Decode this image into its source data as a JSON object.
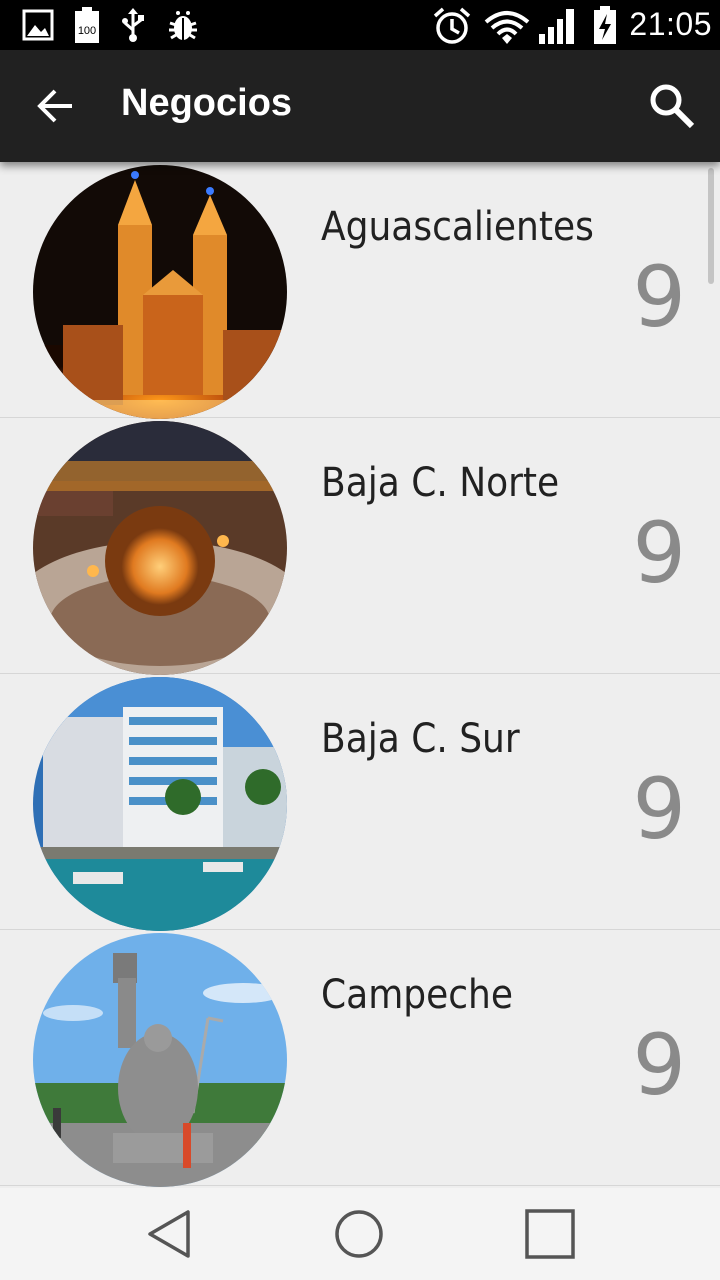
{
  "status_bar": {
    "time": "21:05",
    "battery_text": "100",
    "icons": [
      "image-icon",
      "battery-full-icon",
      "usb-icon",
      "bug-icon",
      "alarm-icon",
      "wifi-icon",
      "signal-icon",
      "battery-charging-icon"
    ]
  },
  "toolbar": {
    "title": "Negocios",
    "back_icon": "arrow-back-icon",
    "search_icon": "search-icon",
    "background": "#212121"
  },
  "list": {
    "items": [
      {
        "name": "Aguascalientes",
        "count": "9"
      },
      {
        "name": "Baja C. Norte",
        "count": "9"
      },
      {
        "name": "Baja C. Sur",
        "count": "9"
      },
      {
        "name": "Campeche",
        "count": "9"
      }
    ]
  },
  "nav_bar": {
    "icons": [
      "back-triangle-icon",
      "home-circle-icon",
      "recents-square-icon"
    ]
  }
}
